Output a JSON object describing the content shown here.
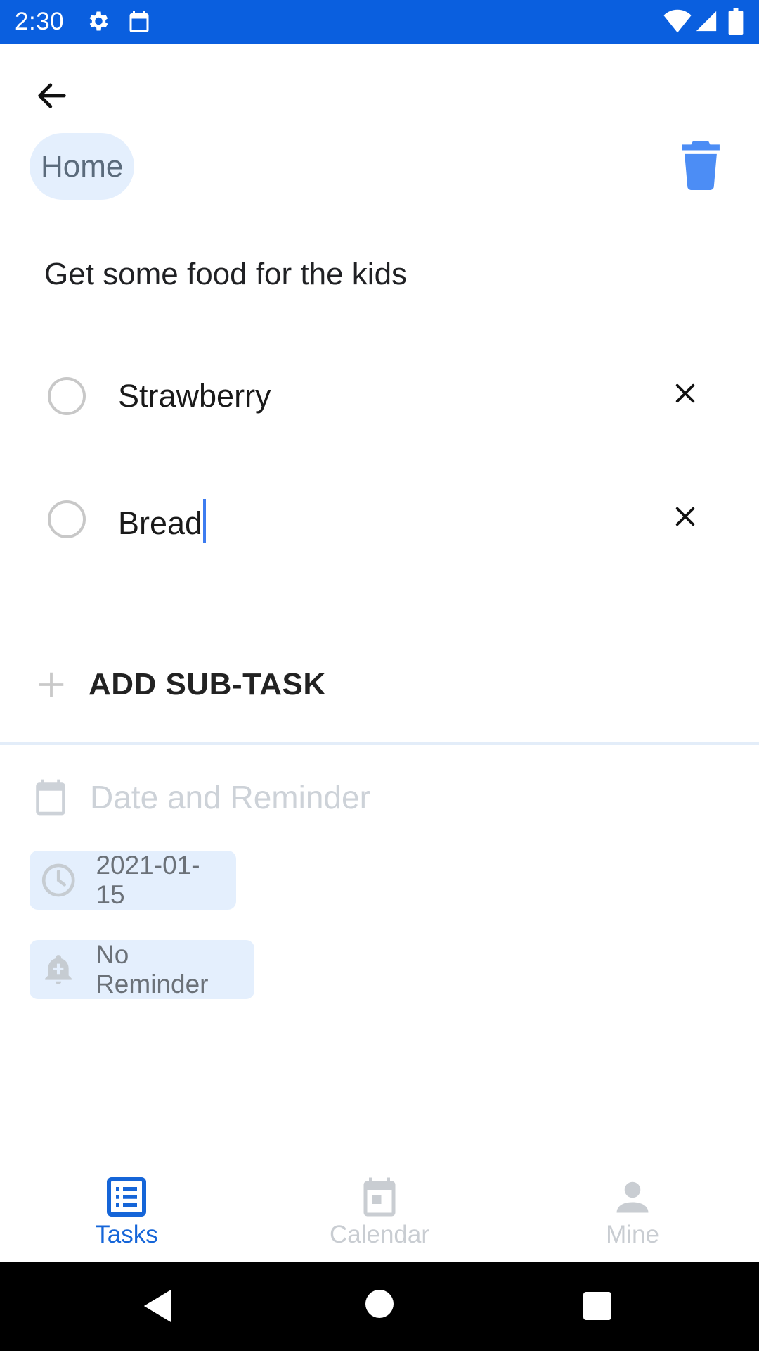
{
  "status_bar": {
    "time": "2:30",
    "icons": [
      "gear-icon",
      "calendar-icon",
      "wifi-icon",
      "signal-icon",
      "battery-icon"
    ],
    "background": "#0a5fdf"
  },
  "header": {
    "back_icon": "arrow-left-icon",
    "category": "Home",
    "delete_icon": "trash-icon"
  },
  "task": {
    "title": "Get some food for the kids",
    "subtasks": [
      {
        "label": "Strawberry",
        "completed": false
      },
      {
        "label": "Bread",
        "completed": false,
        "editing": true
      }
    ],
    "add_subtask_label": "ADD SUB-TASK"
  },
  "date_section": {
    "header": "Date and Reminder",
    "date": "2021-01-15",
    "reminder": "No Reminder"
  },
  "bottom_nav": {
    "items": [
      {
        "label": "Tasks",
        "icon": "list-icon",
        "active": true
      },
      {
        "label": "Calendar",
        "icon": "calendar-icon",
        "active": false
      },
      {
        "label": "Mine",
        "icon": "person-icon",
        "active": false
      }
    ]
  },
  "colors": {
    "accent": "#1565d8",
    "chip_bg": "#e4effd",
    "delete_icon": "#4c8df5"
  }
}
